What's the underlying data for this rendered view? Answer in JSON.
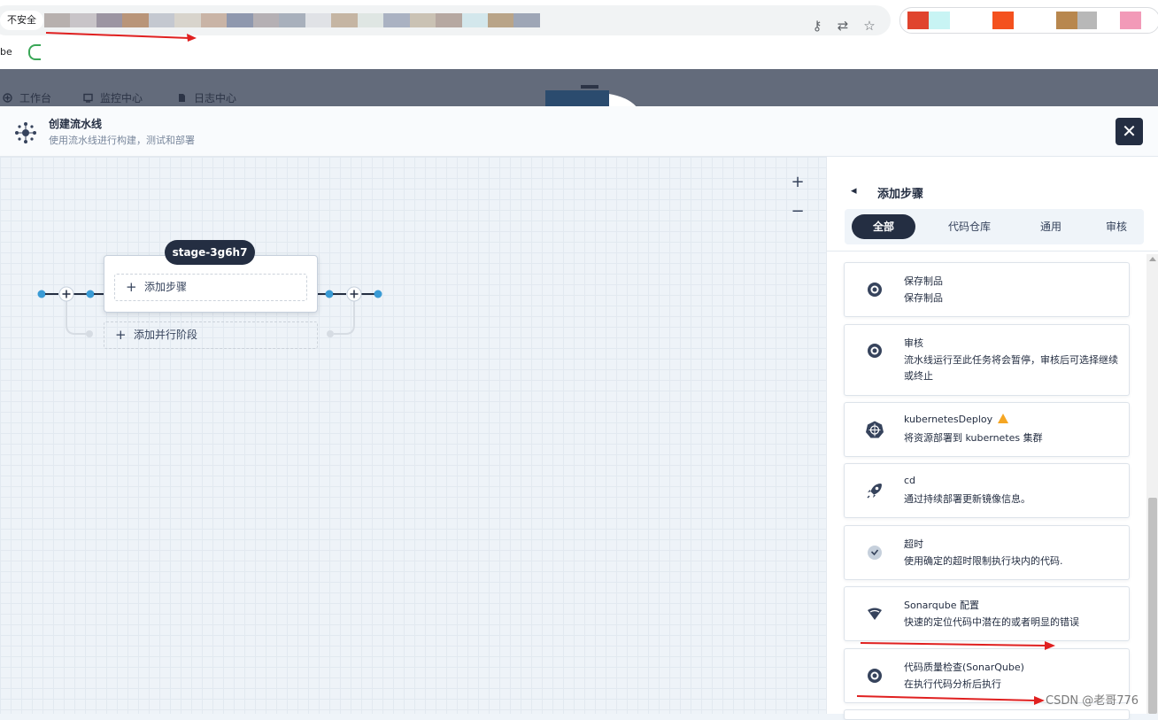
{
  "browser": {
    "security_label": "不安全",
    "bookmark_label": "be"
  },
  "app_nav": {
    "items": [
      {
        "label": "工作台"
      },
      {
        "label": "监控中心"
      },
      {
        "label": "日志中心"
      }
    ]
  },
  "modal": {
    "title": "创建流水线",
    "subtitle": "使用流水线进行构建，测试和部署",
    "close_symbol": "✕"
  },
  "canvas": {
    "zoom_in": "+",
    "zoom_out": "−",
    "stage_name": "stage-3g6h7",
    "add_step_label": "添加步骤",
    "add_parallel_label": "添加并行阶段",
    "plus": "+"
  },
  "panel": {
    "title": "添加步骤",
    "tabs": [
      {
        "label": "全部",
        "active": true
      },
      {
        "label": "代码仓库",
        "active": false
      },
      {
        "label": "通用",
        "active": false
      },
      {
        "label": "审核",
        "active": false
      }
    ],
    "steps": [
      {
        "title": "保存制品",
        "desc": "保存制品",
        "icon": "disc-icon"
      },
      {
        "title": "审核",
        "desc": "流水线运行至此任务将会暂停，审核后可选择继续或终止",
        "icon": "disc-icon"
      },
      {
        "title": "kubernetesDeploy",
        "desc": "将资源部署到 kubernetes 集群",
        "icon": "kubernetes-icon",
        "warning": true
      },
      {
        "title": "cd",
        "desc": "通过持续部署更新镜像信息。",
        "icon": "rocket-icon"
      },
      {
        "title": "超时",
        "desc": "使用确定的超时限制执行块内的代码.",
        "icon": "clock-icon"
      },
      {
        "title": "Sonarqube 配置",
        "desc": "快速的定位代码中潜在的或者明显的错误",
        "icon": "sonar-icon"
      },
      {
        "title": "代码质量检查(SonarQube)",
        "desc": "在执行代码分析后执行",
        "icon": "disc-icon"
      }
    ]
  },
  "watermark": "CSDN @老哥776",
  "colors": {
    "dark": "#242e42",
    "accent_blue": "#3a9bd5",
    "annotation_red": "#e02020"
  }
}
